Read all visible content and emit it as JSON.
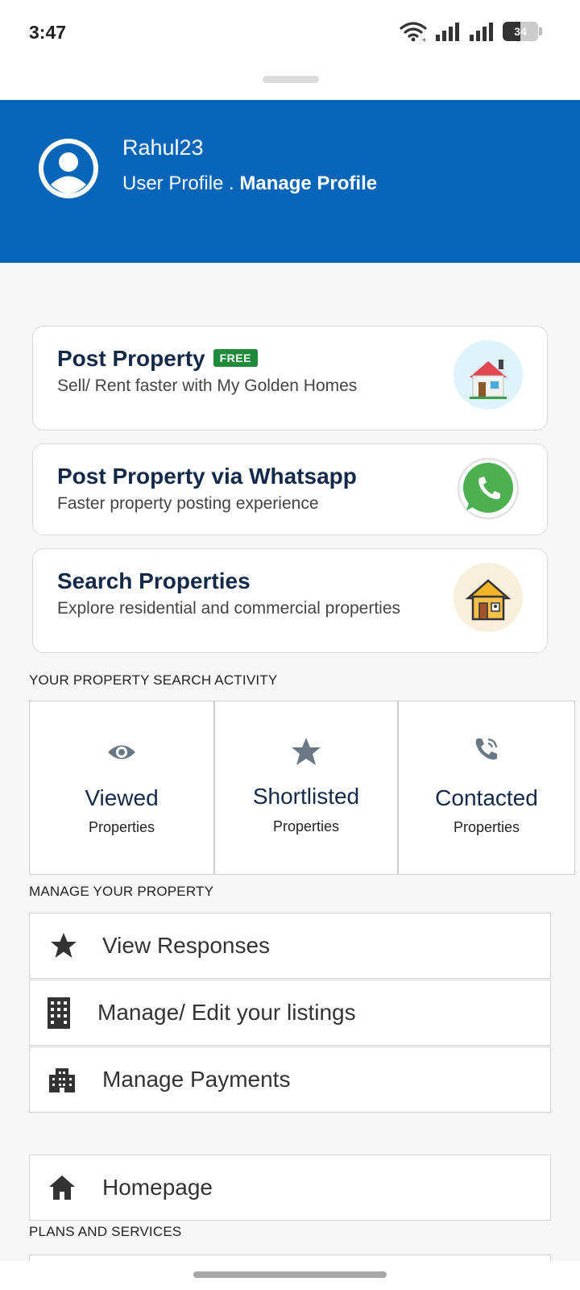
{
  "status_bar": {
    "time": "3:47",
    "battery_level": "34",
    "icons": [
      "wifi-icon",
      "signal-icon",
      "signal-icon",
      "battery-icon"
    ]
  },
  "profile": {
    "username": "Rahul23",
    "subtitle_prefix": "User Profile . ",
    "manage_link": "Manage Profile"
  },
  "cards": [
    {
      "title": "Post Property",
      "badge": "FREE",
      "subtitle": "Sell/ Rent faster with My Golden Homes",
      "icon": "house-icon"
    },
    {
      "title": "Post Property via Whatsapp",
      "subtitle": "Faster property posting experience",
      "icon": "whatsapp-icon"
    },
    {
      "title": "Search Properties",
      "subtitle": "Explore residential and commercial properties",
      "icon": "home-search-icon"
    }
  ],
  "activity": {
    "label": "YOUR PROPERTY SEARCH ACTIVITY",
    "tiles": [
      {
        "title": "Viewed",
        "subtitle": "Properties",
        "icon": "eye-icon"
      },
      {
        "title": "Shortlisted",
        "subtitle": "Properties",
        "icon": "star-icon"
      },
      {
        "title": "Contacted",
        "subtitle": "Properties",
        "icon": "phone-call-icon"
      }
    ]
  },
  "manage": {
    "label": "MANAGE YOUR PROPERTY",
    "items": [
      {
        "label": "View Responses",
        "icon": "star-icon"
      },
      {
        "label": "Manage/ Edit your listings",
        "icon": "building-icon"
      },
      {
        "label": "Manage Payments",
        "icon": "office-icon"
      }
    ]
  },
  "homepage": {
    "label": "Homepage",
    "icon": "home-icon"
  },
  "plans": {
    "label": "PLANS AND SERVICES"
  },
  "colors": {
    "header_blue": "#0565b8",
    "title_navy": "#142848",
    "free_badge_green": "#1f8a3c",
    "whatsapp_green": "#4caf50"
  }
}
